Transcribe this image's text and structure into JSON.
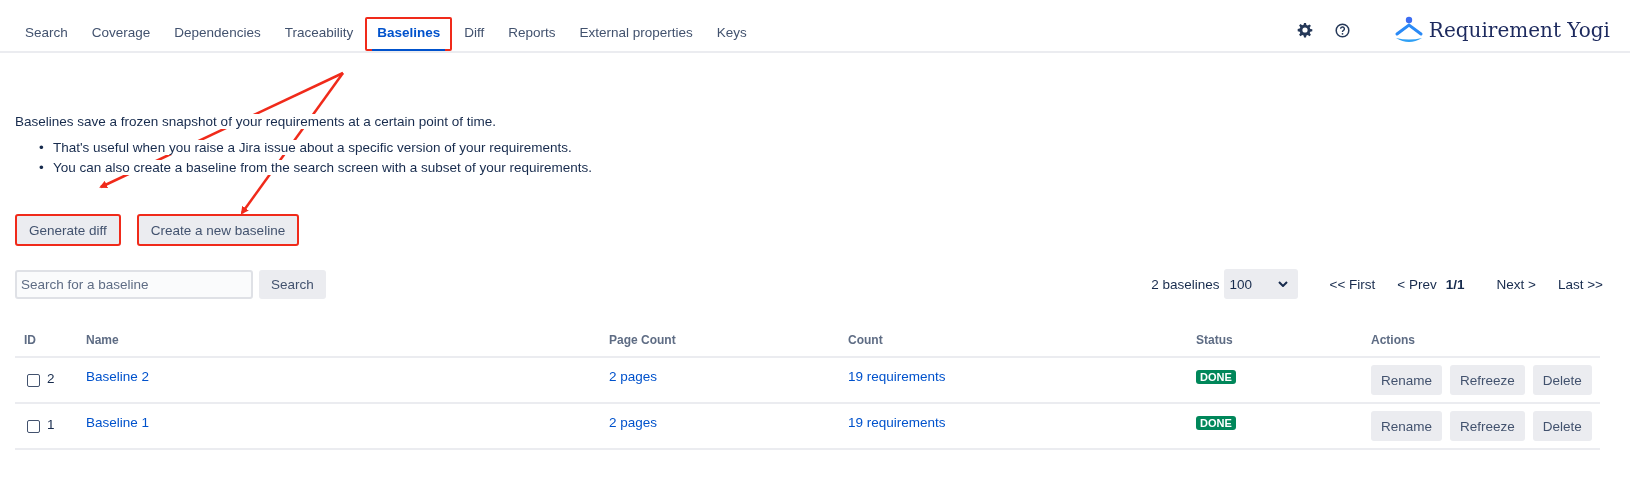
{
  "tabs": [
    {
      "label": "Search",
      "selected": false,
      "annotated": false
    },
    {
      "label": "Coverage",
      "selected": false,
      "annotated": false
    },
    {
      "label": "Dependencies",
      "selected": false,
      "annotated": false
    },
    {
      "label": "Traceability",
      "selected": false,
      "annotated": false
    },
    {
      "label": "Baselines",
      "selected": true,
      "annotated": true
    },
    {
      "label": "Diff",
      "selected": false,
      "annotated": false
    },
    {
      "label": "Reports",
      "selected": false,
      "annotated": false
    },
    {
      "label": "External properties",
      "selected": false,
      "annotated": false
    },
    {
      "label": "Keys",
      "selected": false,
      "annotated": false
    }
  ],
  "logo": {
    "text": "Requirement Yogi"
  },
  "intro": "Baselines save a frozen snapshot of your requirements at a certain point of time.",
  "bullets": [
    {
      "marker": "•",
      "text": "That's useful when you raise a Jira issue about a specific version of your requirements."
    },
    {
      "marker": "•",
      "text": "You can also create a baseline from the search screen with a subset of your requirements."
    }
  ],
  "buttons": [
    {
      "label": "Generate diff",
      "annotated": true
    },
    {
      "label": "Create a new baseline",
      "annotated": true
    }
  ],
  "search": {
    "placeholder": "Search for a baseline",
    "button": "Search"
  },
  "pager": {
    "count": "2 baselines",
    "page_size": "100",
    "first": "<< First",
    "prev": "< Prev",
    "page": "1/1",
    "next": "Next >",
    "last": "Last >>"
  },
  "table": {
    "columns": [
      "ID",
      "Name",
      "Page Count",
      "Count",
      "Status",
      "Actions"
    ],
    "rows": [
      {
        "id": "2",
        "checked": false,
        "name": "Baseline 2",
        "page_count": "2 pages",
        "count": "19 requirements",
        "status": "DONE",
        "actions": [
          "Rename",
          "Refreeze",
          "Delete"
        ]
      },
      {
        "id": "1",
        "checked": false,
        "name": "Baseline 1",
        "page_count": "2 pages",
        "count": "19 requirements",
        "status": "DONE",
        "actions": [
          "Rename",
          "Refreeze",
          "Delete"
        ]
      }
    ]
  }
}
